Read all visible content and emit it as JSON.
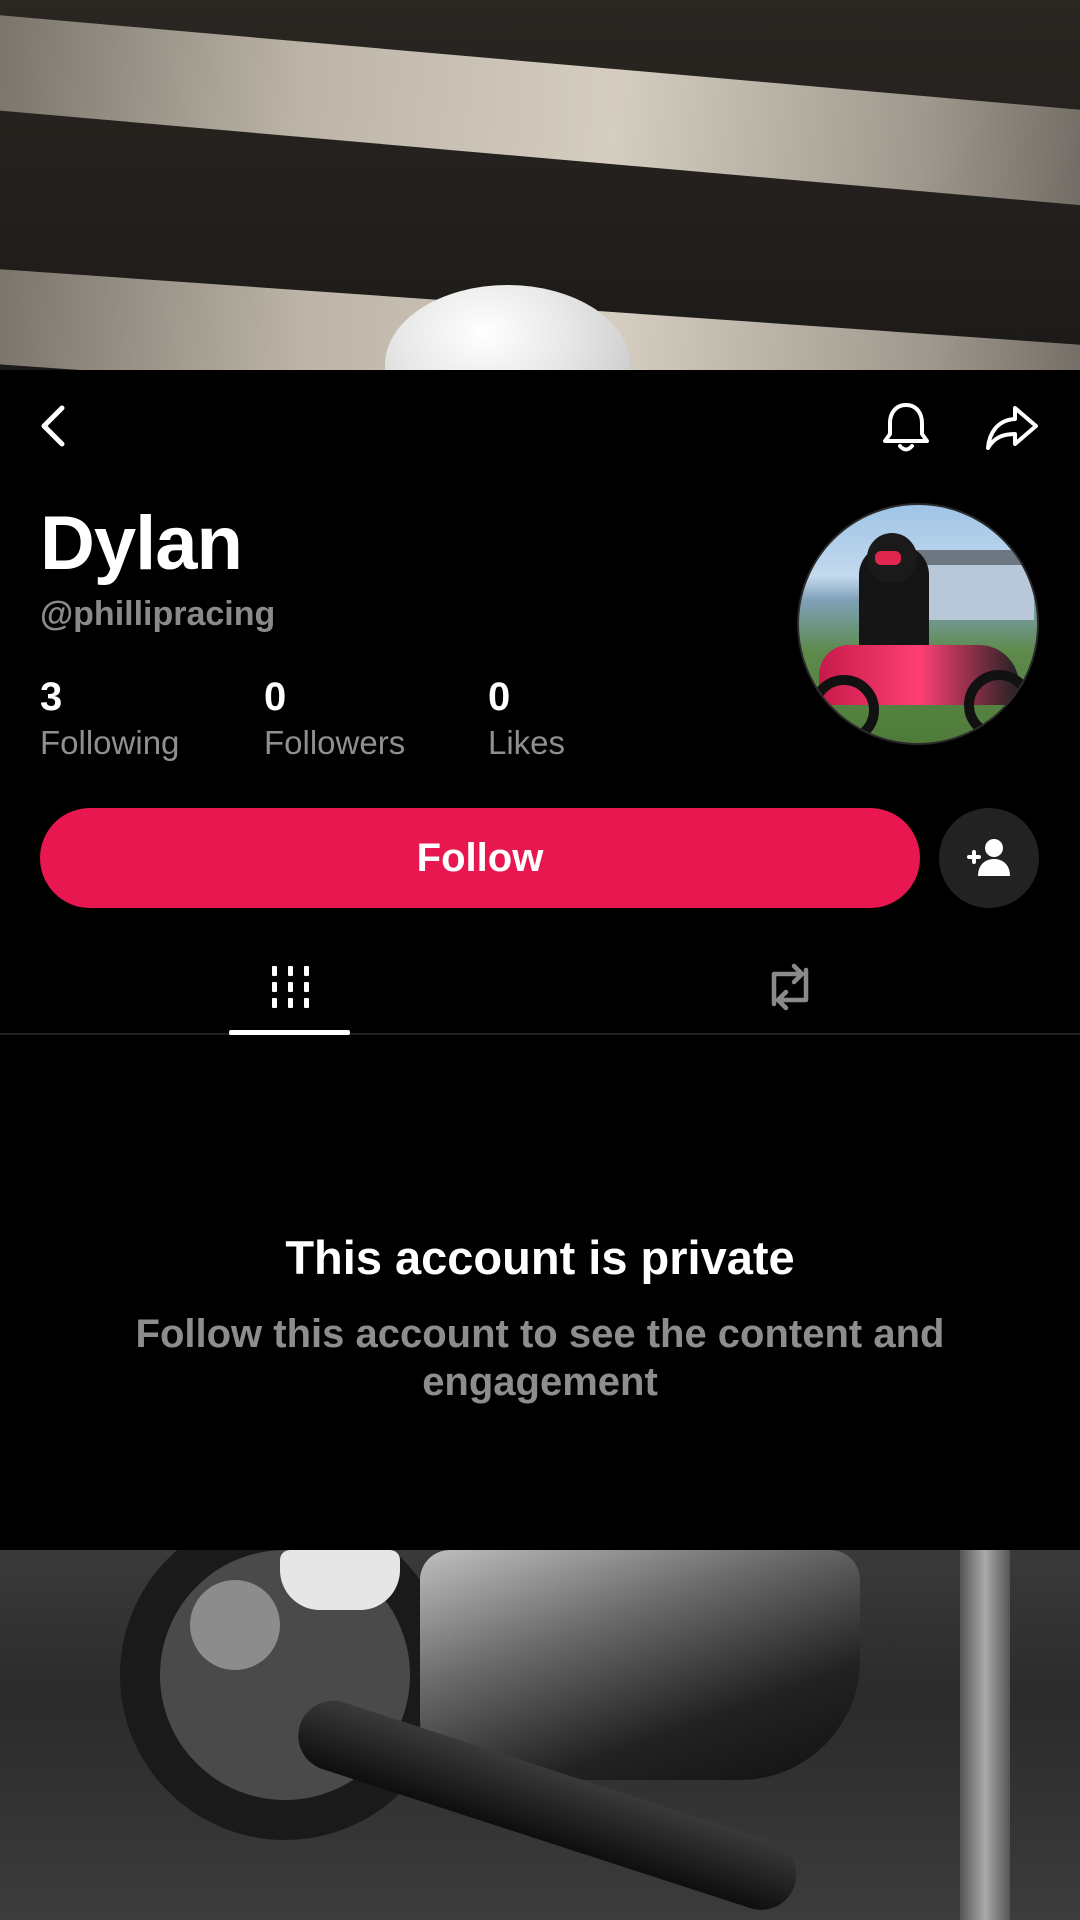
{
  "profile": {
    "display_name": "Dylan",
    "username": "@phillipracing",
    "stats": [
      {
        "value": "3",
        "label": "Following"
      },
      {
        "value": "0",
        "label": "Followers"
      },
      {
        "value": "0",
        "label": "Likes"
      }
    ]
  },
  "actions": {
    "follow_label": "Follow"
  },
  "tabs": [
    {
      "icon": "grid-icon",
      "active": true
    },
    {
      "icon": "repost-icon",
      "active": false
    }
  ],
  "private_notice": {
    "title": "This account is private",
    "message": "Follow this account to see the content and engagement"
  },
  "colors": {
    "accent": "#e8174f",
    "background": "#000000",
    "muted_text": "#8d8d8d"
  }
}
